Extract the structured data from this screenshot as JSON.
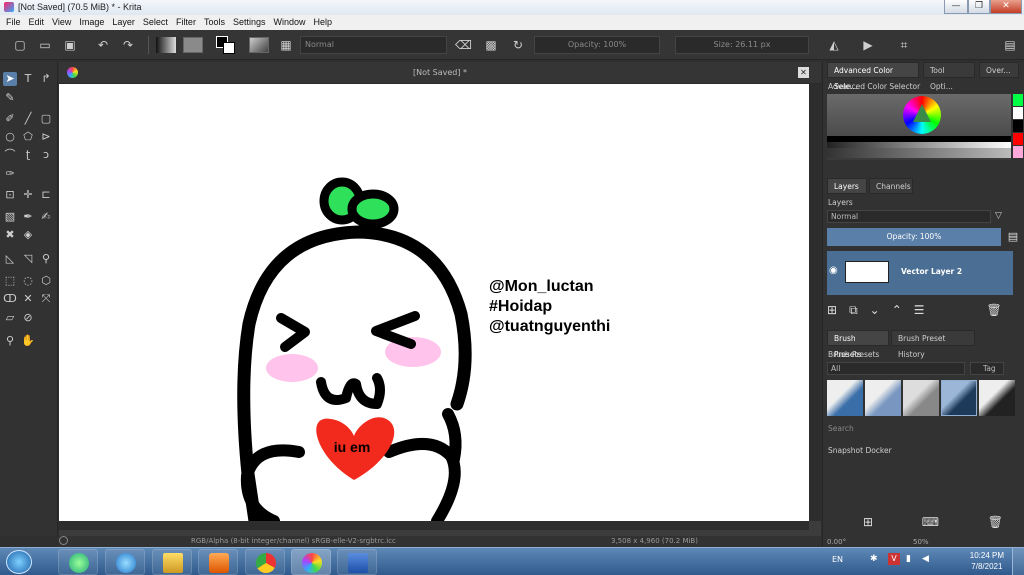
{
  "window": {
    "title": "[Not Saved]  (70.5 MiB)  * - Krita",
    "minimize": "—",
    "maximize": "❐",
    "close": "✕"
  },
  "menu": [
    "File",
    "Edit",
    "View",
    "Image",
    "Layer",
    "Select",
    "Filter",
    "Tools",
    "Settings",
    "Window",
    "Help"
  ],
  "toolbar": {
    "blend_mode": "Normal",
    "opacity": "Opacity: 100%",
    "size": "Size: 26.11 px"
  },
  "document": {
    "tab_title": "[Not Saved]  *",
    "close_icon": "✕"
  },
  "drawing": {
    "heart_text": "iu em",
    "caption_lines": [
      "@Mon_luctan",
      "#Hoidap",
      "@tuatnguyenthi"
    ],
    "colors": {
      "outline": "#000000",
      "sprout": "#2ee05a",
      "blush": "#ffc3ec",
      "heart": "#f22a1e"
    }
  },
  "status": {
    "color_space": "RGB/Alpha (8-bit integer/channel)  sRGB-elle-V2-srgbtrc.icc",
    "dimensions": "3,508 x 4,960 (70.2 MiB)",
    "rotation": "0.00°",
    "zoom": "50%"
  },
  "dock": {
    "top_tabs": [
      "Advanced Color Sele...",
      "Tool Opti...",
      "Over..."
    ],
    "color_selector_title": "Advanced Color Selector",
    "layer_tabs": [
      "Layers",
      "Channels"
    ],
    "layers_title": "Layers",
    "layer_blend": "Normal",
    "layer_opacity": "Opacity:  100%",
    "layer_name": "Vector Layer 2",
    "brush_tabs": [
      "Brush Presets",
      "Brush Preset History"
    ],
    "brush_title": "Brush Presets",
    "brush_filter": "All",
    "brush_tag": "Tag",
    "search_placeholder": "Search",
    "snapshot_title": "Snapshot Docker",
    "swatch_colors": [
      "#00ff44",
      "#ffffff",
      "#000000",
      "#ff0000",
      "#ffaadd"
    ]
  },
  "taskbar": {
    "language": "EN",
    "time": "10:24 PM",
    "date": "7/8/2021"
  }
}
